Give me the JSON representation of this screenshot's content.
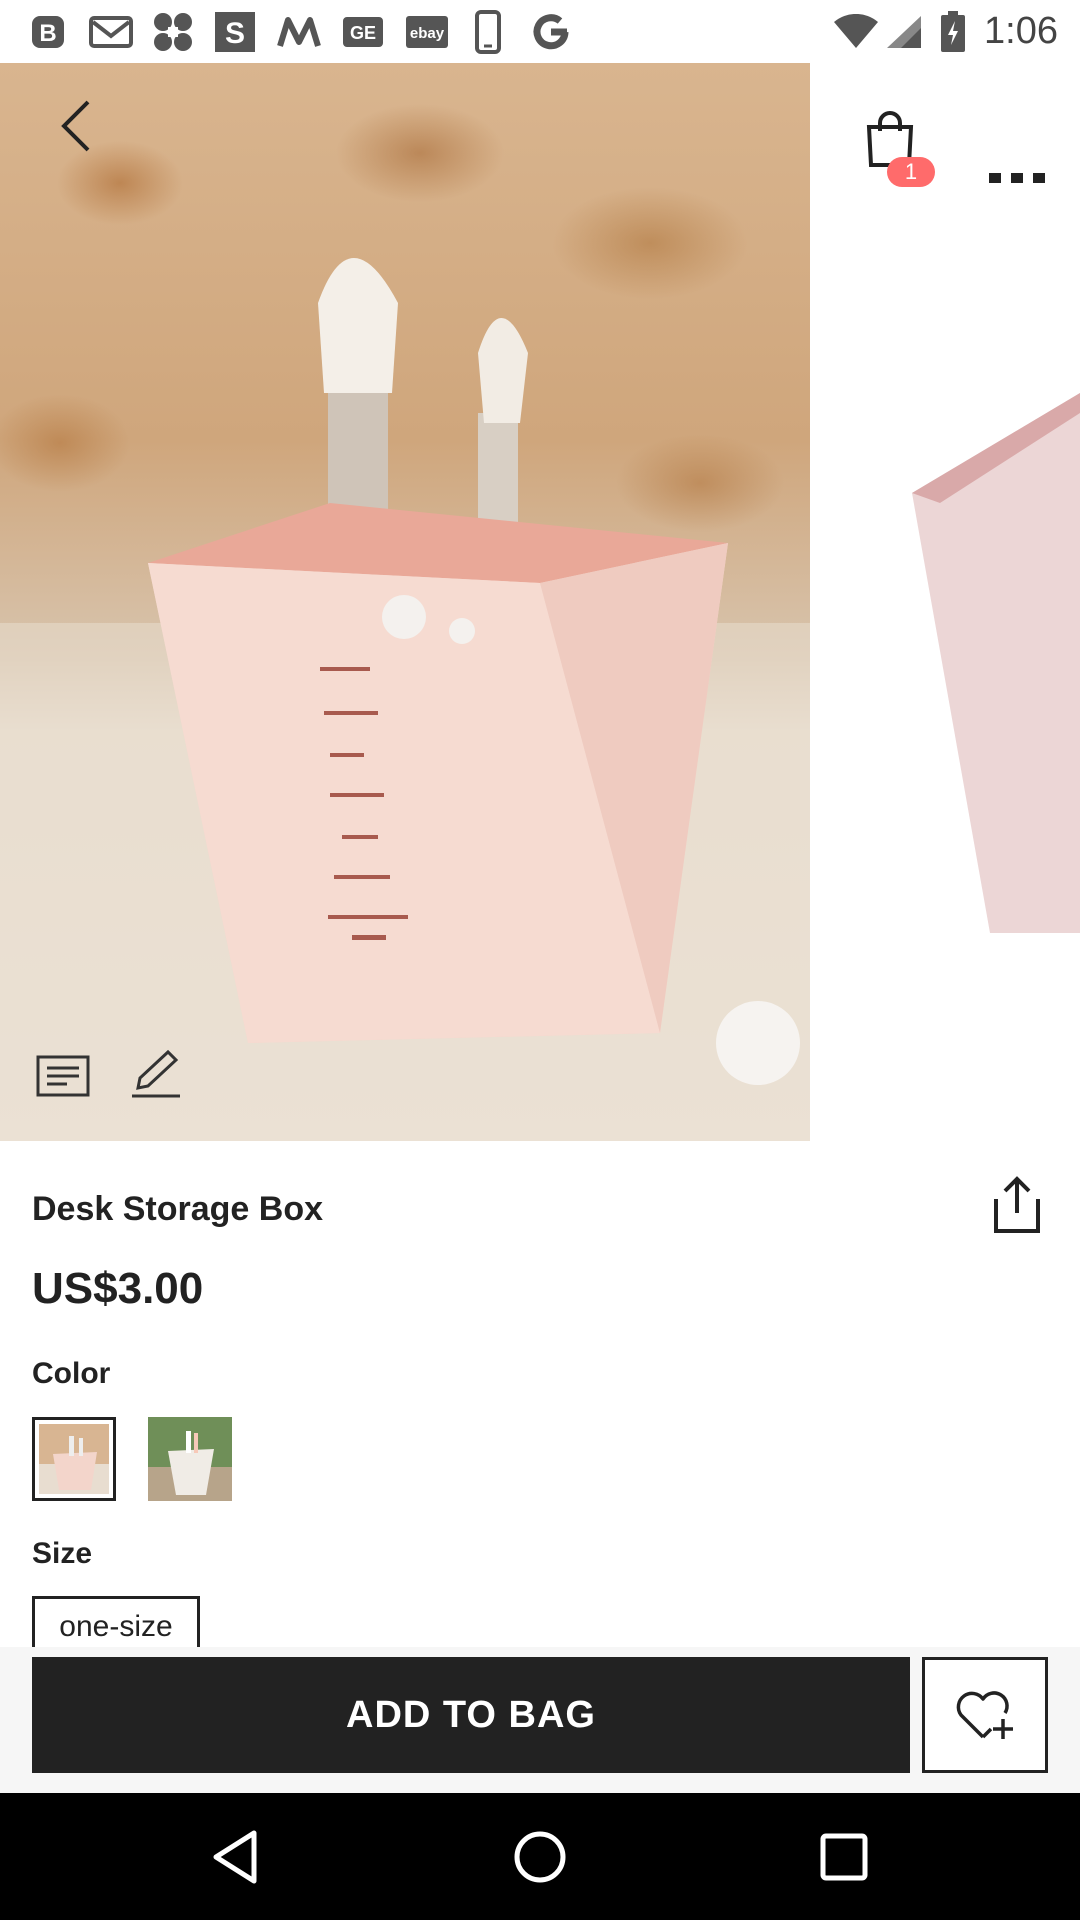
{
  "status_bar": {
    "time": "1:06",
    "icons": [
      "b-icon",
      "gmail-icon",
      "app-icon",
      "s-icon",
      "m-icon",
      "ge-icon",
      "ebay-icon",
      "phone-icon",
      "google-icon",
      "wifi-icon",
      "signal-icon",
      "battery-icon"
    ],
    "ge_text": "GE",
    "ebay_text": "ebay",
    "s_text": "S"
  },
  "header": {
    "cart_count": "1"
  },
  "product": {
    "title": "Desk Storage Box",
    "price": "US$3.00",
    "color_label": "Color",
    "size_label": "Size",
    "size_options": [
      "one-size"
    ]
  },
  "actions": {
    "add_to_bag": "ADD TO BAG"
  },
  "colors": {
    "accent": "#222222",
    "badge": "#ff6b6b",
    "box_pink": "#f3d5cb"
  }
}
